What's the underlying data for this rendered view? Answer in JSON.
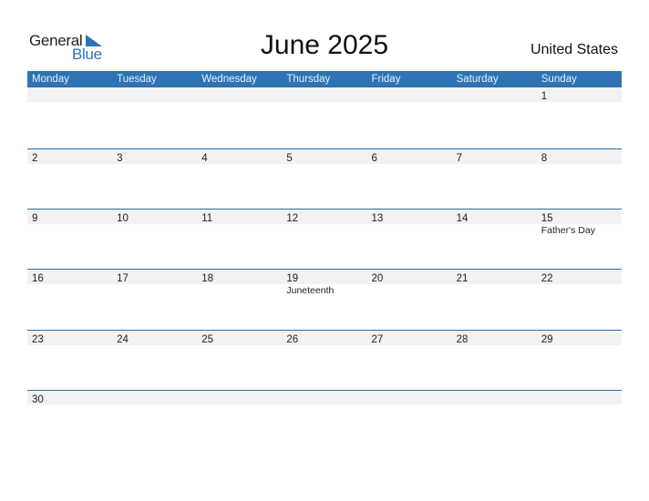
{
  "logo": {
    "line1": "General",
    "line2": "Blue",
    "accent_color": "#2e75b6"
  },
  "title": "June 2025",
  "country": "United States",
  "header_color": "#2e74b5",
  "weekdays": [
    "Monday",
    "Tuesday",
    "Wednesday",
    "Thursday",
    "Friday",
    "Saturday",
    "Sunday"
  ],
  "weeks": [
    {
      "days": [
        {
          "num": "",
          "holiday": ""
        },
        {
          "num": "",
          "holiday": ""
        },
        {
          "num": "",
          "holiday": ""
        },
        {
          "num": "",
          "holiday": ""
        },
        {
          "num": "",
          "holiday": ""
        },
        {
          "num": "",
          "holiday": ""
        },
        {
          "num": "1",
          "holiday": ""
        }
      ]
    },
    {
      "days": [
        {
          "num": "2",
          "holiday": ""
        },
        {
          "num": "3",
          "holiday": ""
        },
        {
          "num": "4",
          "holiday": ""
        },
        {
          "num": "5",
          "holiday": ""
        },
        {
          "num": "6",
          "holiday": ""
        },
        {
          "num": "7",
          "holiday": ""
        },
        {
          "num": "8",
          "holiday": ""
        }
      ]
    },
    {
      "days": [
        {
          "num": "9",
          "holiday": ""
        },
        {
          "num": "10",
          "holiday": ""
        },
        {
          "num": "11",
          "holiday": ""
        },
        {
          "num": "12",
          "holiday": ""
        },
        {
          "num": "13",
          "holiday": ""
        },
        {
          "num": "14",
          "holiday": ""
        },
        {
          "num": "15",
          "holiday": "Father's Day"
        }
      ]
    },
    {
      "days": [
        {
          "num": "16",
          "holiday": ""
        },
        {
          "num": "17",
          "holiday": ""
        },
        {
          "num": "18",
          "holiday": ""
        },
        {
          "num": "19",
          "holiday": "Juneteenth"
        },
        {
          "num": "20",
          "holiday": ""
        },
        {
          "num": "21",
          "holiday": ""
        },
        {
          "num": "22",
          "holiday": ""
        }
      ]
    },
    {
      "days": [
        {
          "num": "23",
          "holiday": ""
        },
        {
          "num": "24",
          "holiday": ""
        },
        {
          "num": "25",
          "holiday": ""
        },
        {
          "num": "26",
          "holiday": ""
        },
        {
          "num": "27",
          "holiday": ""
        },
        {
          "num": "28",
          "holiday": ""
        },
        {
          "num": "29",
          "holiday": ""
        }
      ]
    },
    {
      "days": [
        {
          "num": "30",
          "holiday": ""
        },
        {
          "num": "",
          "holiday": ""
        },
        {
          "num": "",
          "holiday": ""
        },
        {
          "num": "",
          "holiday": ""
        },
        {
          "num": "",
          "holiday": ""
        },
        {
          "num": "",
          "holiday": ""
        },
        {
          "num": "",
          "holiday": ""
        }
      ]
    }
  ]
}
